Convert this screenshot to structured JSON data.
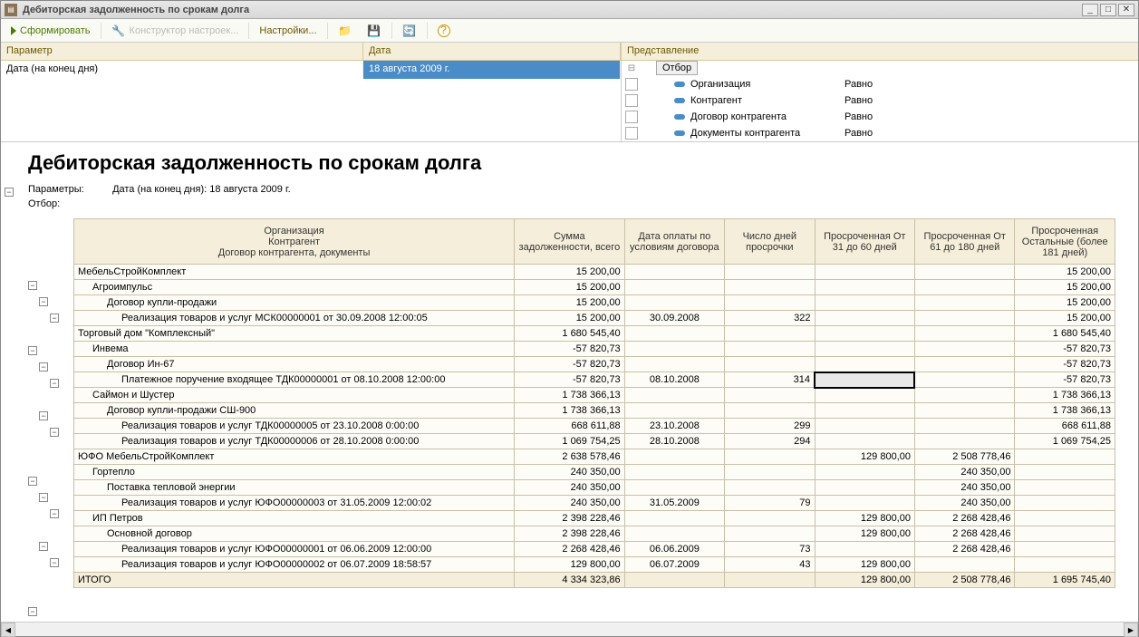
{
  "window": {
    "title": "Дебиторская задолженность по срокам долга"
  },
  "toolbar": {
    "form": "Сформировать",
    "designer": "Конструктор настроек...",
    "settings": "Настройки..."
  },
  "params": {
    "header_param": "Параметр",
    "header_date": "Дата",
    "row_param": "Дата (на конец дня)",
    "row_date": "18 августа 2009 г."
  },
  "filters": {
    "header": "Представление",
    "otbor": "Отбор",
    "items": [
      {
        "name": "Организация",
        "cond": "Равно"
      },
      {
        "name": "Контрагент",
        "cond": "Равно"
      },
      {
        "name": "Договор контрагента",
        "cond": "Равно"
      },
      {
        "name": "Документы контрагента",
        "cond": "Равно"
      }
    ]
  },
  "report": {
    "title": "Дебиторская задолженность по срокам долга",
    "params_label": "Параметры:",
    "params_value": "Дата (на конец дня): 18 августа 2009 г.",
    "filter_label": "Отбор:",
    "columns": {
      "org": "Организация\nКонтрагент\nДоговор контрагента, документы",
      "sum": "Сумма задолженности, всего",
      "paydate": "Дата оплаты по условиям договора",
      "days": "Число дней просрочки",
      "overdue31": "Просроченная От 31 до 60 дней",
      "overdue61": "Просроченная От 61 до 180 дней",
      "overdueRest": "Просроченная Остальные (более 181 дней)"
    },
    "rows": [
      {
        "lvl": 0,
        "name": "МебельСтройКомплект",
        "sum": "15 200,00",
        "rest": "15 200,00"
      },
      {
        "lvl": 1,
        "name": "Агроимпульс",
        "sum": "15 200,00",
        "rest": "15 200,00"
      },
      {
        "lvl": 2,
        "name": "Договор купли-продажи",
        "sum": "15 200,00",
        "rest": "15 200,00"
      },
      {
        "lvl": 3,
        "name": "Реализация товаров и услуг МСК00000001 от 30.09.2008 12:00:05",
        "sum": "15 200,00",
        "date": "30.09.2008",
        "days": "322",
        "rest": "15 200,00"
      },
      {
        "lvl": 0,
        "name": "Торговый дом \"Комплексный\"",
        "sum": "1 680 545,40",
        "rest": "1 680 545,40"
      },
      {
        "lvl": 1,
        "name": "Инвема",
        "sum": "-57 820,73",
        "rest": "-57 820,73"
      },
      {
        "lvl": 2,
        "name": "Договор Ин-67",
        "sum": "-57 820,73",
        "rest": "-57 820,73"
      },
      {
        "lvl": 3,
        "name": "Платежное поручение входящее ТДК00000001 от 08.10.2008 12:00:00",
        "sum": "-57 820,73",
        "date": "08.10.2008",
        "days": "314",
        "rest": "-57 820,73",
        "selected": true
      },
      {
        "lvl": 1,
        "name": "Саймон и Шустер",
        "sum": "1 738 366,13",
        "rest": "1 738 366,13"
      },
      {
        "lvl": 2,
        "name": "Договор купли-продажи СШ-900",
        "sum": "1 738 366,13",
        "rest": "1 738 366,13"
      },
      {
        "lvl": 3,
        "name": "Реализация товаров и услуг ТДК00000005 от 23.10.2008 0:00:00",
        "sum": "668 611,88",
        "date": "23.10.2008",
        "days": "299",
        "rest": "668 611,88"
      },
      {
        "lvl": 3,
        "name": "Реализация товаров и услуг ТДК00000006 от 28.10.2008 0:00:00",
        "sum": "1 069 754,25",
        "date": "28.10.2008",
        "days": "294",
        "rest": "1 069 754,25"
      },
      {
        "lvl": 0,
        "name": "ЮФО МебельСтройКомплект",
        "sum": "2 638 578,46",
        "o31": "129 800,00",
        "o61": "2 508 778,46"
      },
      {
        "lvl": 1,
        "name": "Гортепло",
        "sum": "240 350,00",
        "o61": "240 350,00"
      },
      {
        "lvl": 2,
        "name": "Поставка тепловой энергии",
        "sum": "240 350,00",
        "o61": "240 350,00"
      },
      {
        "lvl": 3,
        "name": "Реализация товаров и услуг ЮФО00000003 от 31.05.2009 12:00:02",
        "sum": "240 350,00",
        "date": "31.05.2009",
        "days": "79",
        "o61": "240 350,00"
      },
      {
        "lvl": 1,
        "name": "ИП Петров",
        "sum": "2 398 228,46",
        "o31": "129 800,00",
        "o61": "2 268 428,46"
      },
      {
        "lvl": 2,
        "name": "Основной договор",
        "sum": "2 398 228,46",
        "o31": "129 800,00",
        "o61": "2 268 428,46"
      },
      {
        "lvl": 3,
        "name": "Реализация товаров и услуг ЮФО00000001 от 06.06.2009 12:00:00",
        "sum": "2 268 428,46",
        "date": "06.06.2009",
        "days": "73",
        "o61": "2 268 428,46"
      },
      {
        "lvl": 3,
        "name": "Реализация товаров и услуг ЮФО00000002 от 06.07.2009 18:58:57",
        "sum": "129 800,00",
        "date": "06.07.2009",
        "days": "43",
        "o31": "129 800,00"
      }
    ],
    "total": {
      "name": "ИТОГО",
      "sum": "4 334 323,86",
      "o31": "129 800,00",
      "o61": "2 508 778,46",
      "rest": "1 695 745,40"
    }
  }
}
